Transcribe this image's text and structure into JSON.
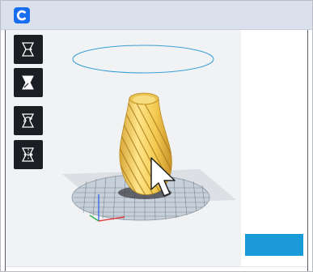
{
  "app": {
    "name": "Cura",
    "logo_letter": "C",
    "accent_color": "#1a9bd7",
    "logo_color": "#196ef0"
  },
  "toolbar": {
    "tools": [
      {
        "name": "move-tool",
        "icon": "move-icon",
        "selected": false
      },
      {
        "name": "scale-tool",
        "icon": "scale-icon",
        "selected": true
      },
      {
        "name": "rotate-tool",
        "icon": "rotate-icon",
        "selected": false
      },
      {
        "name": "mirror-tool",
        "icon": "mirror-icon",
        "selected": false
      }
    ]
  },
  "viewport": {
    "model": "spiral-vase",
    "model_color": "#f3d35c",
    "build_plate": "circular-grid",
    "cursor": "arrow-pointer"
  },
  "action_panel": {
    "button_label": ""
  }
}
